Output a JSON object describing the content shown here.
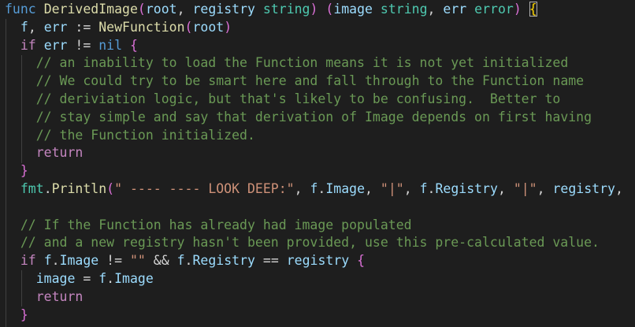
{
  "code": {
    "lines": [
      [
        {
          "t": "func",
          "c": "kw"
        },
        {
          "t": " ",
          "c": "op"
        },
        {
          "t": "DerivedImage",
          "c": "fn"
        },
        {
          "t": "(",
          "c": "br2"
        },
        {
          "t": "root",
          "c": "vr"
        },
        {
          "t": ", ",
          "c": "op"
        },
        {
          "t": "registry",
          "c": "vr"
        },
        {
          "t": " ",
          "c": "op"
        },
        {
          "t": "string",
          "c": "ty"
        },
        {
          "t": ")",
          "c": "br2"
        },
        {
          "t": " ",
          "c": "op"
        },
        {
          "t": "(",
          "c": "br2"
        },
        {
          "t": "image",
          "c": "vr"
        },
        {
          "t": " ",
          "c": "op"
        },
        {
          "t": "string",
          "c": "ty"
        },
        {
          "t": ", ",
          "c": "op"
        },
        {
          "t": "err",
          "c": "vr"
        },
        {
          "t": " ",
          "c": "op"
        },
        {
          "t": "error",
          "c": "ty"
        },
        {
          "t": ")",
          "c": "br2"
        },
        {
          "t": " ",
          "c": "op"
        },
        {
          "t": "{",
          "c": "br1 brk-box"
        }
      ],
      [
        {
          "t": "  ",
          "c": "op"
        },
        {
          "t": "f",
          "c": "vr"
        },
        {
          "t": ", ",
          "c": "op"
        },
        {
          "t": "err",
          "c": "vr"
        },
        {
          "t": " := ",
          "c": "op"
        },
        {
          "t": "NewFunction",
          "c": "fn"
        },
        {
          "t": "(",
          "c": "br2"
        },
        {
          "t": "root",
          "c": "vr"
        },
        {
          "t": ")",
          "c": "br2"
        }
      ],
      [
        {
          "t": "  ",
          "c": "op"
        },
        {
          "t": "if",
          "c": "kwc"
        },
        {
          "t": " ",
          "c": "op"
        },
        {
          "t": "err",
          "c": "vr"
        },
        {
          "t": " != ",
          "c": "op"
        },
        {
          "t": "nil",
          "c": "kw"
        },
        {
          "t": " ",
          "c": "op"
        },
        {
          "t": "{",
          "c": "br2"
        }
      ],
      [
        {
          "t": "    ",
          "c": "op"
        },
        {
          "t": "// an inability to load the Function means it is not yet initialized",
          "c": "cm"
        }
      ],
      [
        {
          "t": "    ",
          "c": "op"
        },
        {
          "t": "// We could try to be smart here and fall through to the Function name",
          "c": "cm"
        }
      ],
      [
        {
          "t": "    ",
          "c": "op"
        },
        {
          "t": "// deriviation logic, but that's likely to be confusing.  Better to",
          "c": "cm"
        }
      ],
      [
        {
          "t": "    ",
          "c": "op"
        },
        {
          "t": "// stay simple and say that derivation of Image depends on first having",
          "c": "cm"
        }
      ],
      [
        {
          "t": "    ",
          "c": "op"
        },
        {
          "t": "// the Function initialized.",
          "c": "cm"
        }
      ],
      [
        {
          "t": "    ",
          "c": "op"
        },
        {
          "t": "return",
          "c": "kwc"
        }
      ],
      [
        {
          "t": "  ",
          "c": "op"
        },
        {
          "t": "}",
          "c": "br2"
        }
      ],
      [
        {
          "t": "  ",
          "c": "op"
        },
        {
          "t": "fmt",
          "c": "ty"
        },
        {
          "t": ".",
          "c": "op"
        },
        {
          "t": "Println",
          "c": "fn"
        },
        {
          "t": "(",
          "c": "br2"
        },
        {
          "t": "\" ---- ---- LOOK DEEP:\"",
          "c": "st"
        },
        {
          "t": ", ",
          "c": "op"
        },
        {
          "t": "f",
          "c": "vr"
        },
        {
          "t": ".",
          "c": "op"
        },
        {
          "t": "Image",
          "c": "vr"
        },
        {
          "t": ", ",
          "c": "op"
        },
        {
          "t": "\"|\"",
          "c": "st"
        },
        {
          "t": ", ",
          "c": "op"
        },
        {
          "t": "f",
          "c": "vr"
        },
        {
          "t": ".",
          "c": "op"
        },
        {
          "t": "Registry",
          "c": "vr"
        },
        {
          "t": ", ",
          "c": "op"
        },
        {
          "t": "\"|\"",
          "c": "st"
        },
        {
          "t": ", ",
          "c": "op"
        },
        {
          "t": "registry",
          "c": "vr"
        },
        {
          "t": ",",
          "c": "op"
        }
      ],
      [],
      [
        {
          "t": "  ",
          "c": "op"
        },
        {
          "t": "// If the Function has already had image populated",
          "c": "cm"
        }
      ],
      [
        {
          "t": "  ",
          "c": "op"
        },
        {
          "t": "// and a new registry hasn't been provided, use this pre-calculated value.",
          "c": "cm"
        }
      ],
      [
        {
          "t": "  ",
          "c": "op"
        },
        {
          "t": "if",
          "c": "kwc"
        },
        {
          "t": " ",
          "c": "op"
        },
        {
          "t": "f",
          "c": "vr"
        },
        {
          "t": ".",
          "c": "op"
        },
        {
          "t": "Image",
          "c": "vr"
        },
        {
          "t": " != ",
          "c": "op"
        },
        {
          "t": "\"\"",
          "c": "st"
        },
        {
          "t": " && ",
          "c": "op"
        },
        {
          "t": "f",
          "c": "vr"
        },
        {
          "t": ".",
          "c": "op"
        },
        {
          "t": "Registry",
          "c": "vr"
        },
        {
          "t": " == ",
          "c": "op"
        },
        {
          "t": "registry",
          "c": "vr"
        },
        {
          "t": " ",
          "c": "op"
        },
        {
          "t": "{",
          "c": "br2"
        }
      ],
      [
        {
          "t": "    ",
          "c": "op"
        },
        {
          "t": "image",
          "c": "vr"
        },
        {
          "t": " = ",
          "c": "op"
        },
        {
          "t": "f",
          "c": "vr"
        },
        {
          "t": ".",
          "c": "op"
        },
        {
          "t": "Image",
          "c": "vr"
        }
      ],
      [
        {
          "t": "    ",
          "c": "op"
        },
        {
          "t": "return",
          "c": "kwc"
        }
      ],
      [
        {
          "t": "  ",
          "c": "op"
        },
        {
          "t": "}",
          "c": "br2"
        }
      ]
    ]
  }
}
